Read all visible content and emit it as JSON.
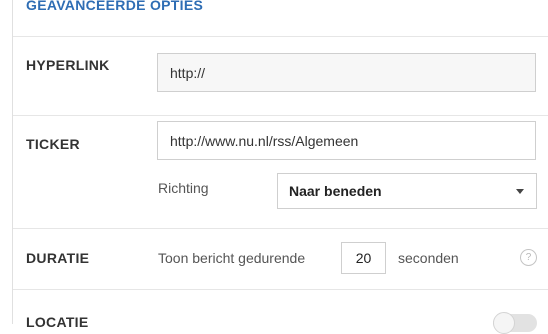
{
  "section_title": "GEAVANCEERDE OPTIES",
  "hyperlink": {
    "label": "HYPERLINK",
    "value": "http://"
  },
  "ticker": {
    "label": "TICKER",
    "value": "http://www.nu.nl/rss/Algemeen",
    "direction_label": "Richting",
    "direction_value": "Naar beneden"
  },
  "duration": {
    "label": "DURATIE",
    "prefix": "Toon bericht gedurende",
    "value": "20",
    "suffix": "seconden",
    "help_icon": "question-icon"
  },
  "location": {
    "label": "LOCATIE",
    "toggle_on": false
  },
  "colors": {
    "section_title": "#2e6db4",
    "border": "#cfcfcf",
    "input_bg": "#f7f7f7"
  }
}
